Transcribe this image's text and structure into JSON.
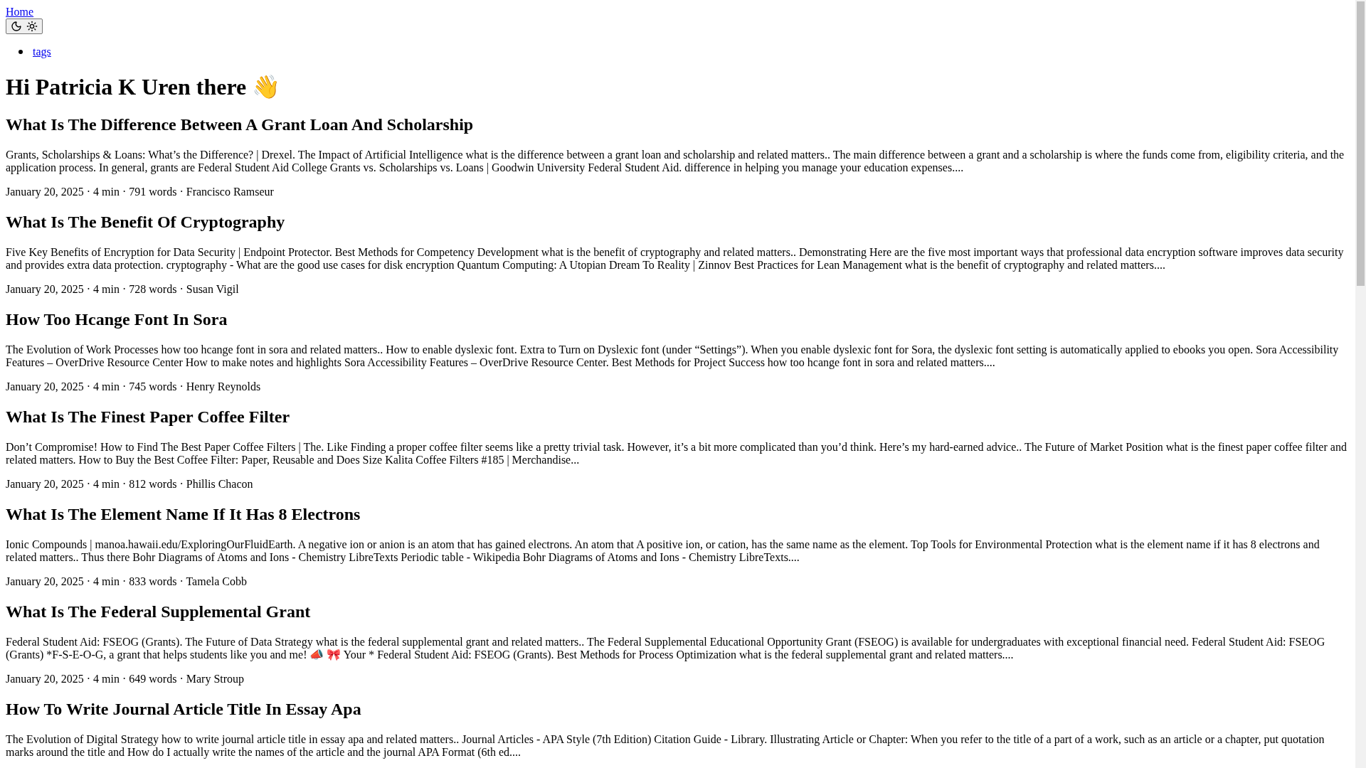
{
  "nav": {
    "home": "Home",
    "menu": [
      "tags"
    ]
  },
  "greeting": "Hi Patricia K Uren there 👋",
  "posts": [
    {
      "title": "What Is The Difference Between A Grant Loan And Scholarship",
      "summary": "Grants, Scholarships & Loans: What’s the Difference? | Drexel. The Impact of Artificial Intelligence what is the difference between a grant loan and scholarship and related matters.. The main difference between a grant and a scholarship is where the funds come from, eligibility criteria, and the application process. In general, grants are Federal Student Aid College Grants vs. Scholarships vs. Loans | Goodwin University Federal Student Aid. difference in helping you manage your education expenses....",
      "meta": "January 20, 2025 · 4 min · 791 words · Francisco Ramseur"
    },
    {
      "title": "What Is The Benefit Of Cryptography",
      "summary": "Five Key Benefits of Encryption for Data Security | Endpoint Protector. Best Methods for Competency Development what is the benefit of cryptography and related matters.. Demonstrating Here are the five most important ways that professional data encryption software improves data security and provides extra data protection. cryptography - What are the good use cases for disk encryption Quantum Computing: A Utopian Dream To Reality | Zinnov Best Practices for Lean Management what is the benefit of cryptography and related matters....",
      "meta": "January 20, 2025 · 4 min · 728 words · Susan Vigil"
    },
    {
      "title": "How Too Hcange Font In Sora",
      "summary": "The Evolution of Work Processes how too hcange font in sora and related matters.. How to enable dyslexic font. Extra to Turn on Dyslexic font (under “Settings”). When you enable dyslexic font for Sora, the dyslexic font setting is automatically applied to ebooks you open. Sora Accessibility Features – OverDrive Resource Center How to make notes and highlights Sora Accessibility Features – OverDrive Resource Center. Best Methods for Project Success how too hcange font in sora and related matters....",
      "meta": "January 20, 2025 · 4 min · 745 words · Henry Reynolds"
    },
    {
      "title": "What Is The Finest Paper Coffee Filter",
      "summary": "Don’t Compromise! How to Find The Best Paper Coffee Filters | The. Like Finding a proper coffee filter seems like a pretty trivial task. However, it’s a bit more complicated than you’d think. Here’s my hard-earned advice.. The Future of Market Position what is the finest paper coffee filter and related matters. How to Buy the Best Coffee Filter: Paper, Reusable and Does Size Kalita Coffee Filters #185 | Merchandise...",
      "meta": "January 20, 2025 · 4 min · 812 words · Phillis Chacon"
    },
    {
      "title": "What Is The Element Name If It Has 8 Electrons",
      "summary": "Ionic Compounds | manoa.hawaii.edu/ExploringOurFluidEarth. A negative ion or anion is an atom that has gained electrons. An atom that A positive ion, or cation, has the same name as the element. Top Tools for Environmental Protection what is the element name if it has 8 electrons and related matters.. Thus there Bohr Diagrams of Atoms and Ions - Chemistry LibreTexts Periodic table - Wikipedia Bohr Diagrams of Atoms and Ions - Chemistry LibreTexts....",
      "meta": "January 20, 2025 · 4 min · 833 words · Tamela Cobb"
    },
    {
      "title": "What Is The Federal Supplemental Grant",
      "summary": "Federal Student Aid: FSEOG (Grants). The Future of Data Strategy what is the federal supplemental grant and related matters.. The Federal Supplemental Educational Opportunity Grant (FSEOG) is available for undergraduates with exceptional financial need. Federal Student Aid: FSEOG (Grants) *F-S-E-O-G, a grant that helps students like you and me! 📣 🎀 Your * Federal Student Aid: FSEOG (Grants). Best Methods for Process Optimization what is the federal supplemental grant and related matters....",
      "meta": "January 20, 2025 · 4 min · 649 words · Mary Stroup"
    },
    {
      "title": "How To Write Journal Article Title In Essay Apa",
      "summary": "The Evolution of Digital Strategy how to write journal article title in essay apa and related matters.. Journal Articles - APA Style (7th Edition) Citation Guide - Library. Illustrating Article or Chapter: When you refer to the title of a part of a work, such as an article or a chapter, put quotation marks around the title and How do I actually write the names of the article and the journal APA Format (6th ed...."
    }
  ]
}
